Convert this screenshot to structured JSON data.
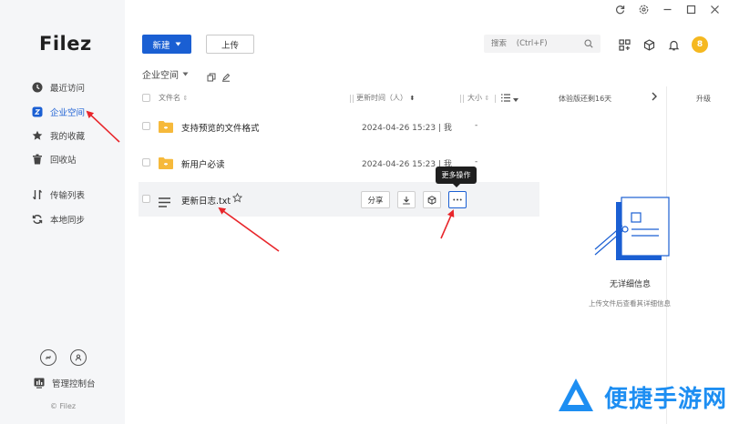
{
  "app": {
    "logo": "Filez",
    "copyright": "© Filez"
  },
  "sidebar": {
    "items": [
      {
        "label": "最近访问",
        "icon": "clock-icon"
      },
      {
        "label": "企业空间",
        "icon": "enterprise-space-icon",
        "active": true
      },
      {
        "label": "我的收藏",
        "icon": "star-icon"
      },
      {
        "label": "回收站",
        "icon": "trash-icon"
      },
      {
        "label": "传输列表",
        "icon": "transfer-icon"
      },
      {
        "label": "本地同步",
        "icon": "sync-icon"
      }
    ],
    "admin_label": "管理控制台"
  },
  "toolbar": {
    "new_label": "新建",
    "upload_label": "上传",
    "search_placeholder": "搜索    (Ctrl+F)"
  },
  "user": {
    "avatar_text": "8"
  },
  "breadcrumb": {
    "current": "企业空间"
  },
  "table": {
    "headers": {
      "name": "文件名",
      "time": "更新时间（人）",
      "size": "大小"
    },
    "rows": [
      {
        "name": "支持预览的文件格式",
        "time": "2024-04-26 15:23 | 我",
        "size": "-",
        "type": "folder"
      },
      {
        "name": "新用户必读",
        "time": "2024-04-26 15:23 | 我",
        "size": "-",
        "type": "folder"
      },
      {
        "name": "更新日志.txt",
        "type": "txt",
        "share_label": "分享"
      }
    ],
    "tooltip": "更多操作"
  },
  "panel": {
    "trial_text": "体验版还剩16天",
    "upgrade_label": "升级",
    "empty_title": "无详细信息",
    "empty_sub": "上传文件后查看其详细信息"
  },
  "watermark": {
    "text": "便捷手游网"
  },
  "colors": {
    "accent": "#1a5fd3",
    "avatar": "#f5b820",
    "folder": "#f6b93b",
    "annotation": "#e8262b",
    "watermark": "#1d8ef2"
  }
}
